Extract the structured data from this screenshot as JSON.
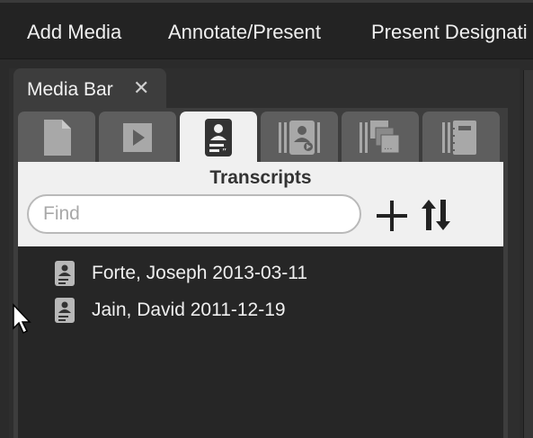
{
  "menu": {
    "items": [
      "Add Media",
      "Annotate/Present",
      "Present Designati"
    ]
  },
  "panel_tab": {
    "label": "Media Bar",
    "close_glyph": "✕"
  },
  "media_tabs": [
    {
      "name": "documents",
      "icon": "document-icon",
      "active": false
    },
    {
      "name": "video",
      "icon": "play-icon",
      "active": false
    },
    {
      "name": "transcripts",
      "icon": "transcript-icon",
      "active": true
    },
    {
      "name": "video-clips",
      "icon": "clip-icon",
      "active": false
    },
    {
      "name": "slides",
      "icon": "stack-icon",
      "active": false
    },
    {
      "name": "notebook",
      "icon": "notebook-icon",
      "active": false
    }
  ],
  "transcripts": {
    "title": "Transcripts",
    "find_placeholder": "Find",
    "find_value": "",
    "items": [
      {
        "label": "Forte, Joseph 2013-03-11",
        "icon": "transcript-icon"
      },
      {
        "label": "Jain, David 2011-12-19",
        "icon": "transcript-icon"
      }
    ]
  },
  "colors": {
    "background": "#2b2b2b",
    "topbar": "#232323",
    "tab_inactive": "#5e5e5e",
    "tab_active": "#f0f0f0",
    "list_bg": "#262626"
  }
}
